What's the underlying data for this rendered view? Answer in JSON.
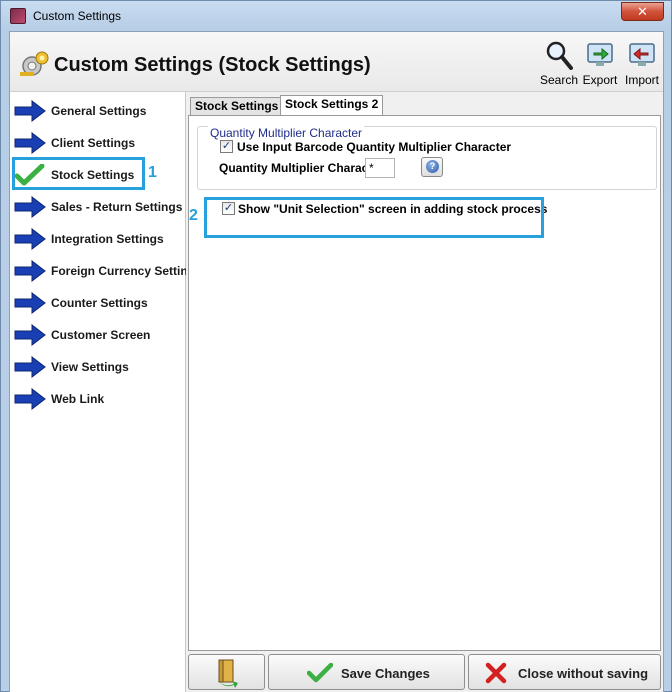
{
  "window": {
    "title": "Custom Settings",
    "close_glyph": "✕"
  },
  "header": {
    "title": "Custom Settings (Stock Settings)",
    "buttons": [
      {
        "label": "Search",
        "icon": "magnifier-icon"
      },
      {
        "label": "Export",
        "icon": "monitor-export-icon"
      },
      {
        "label": "Import",
        "icon": "monitor-import-icon"
      }
    ]
  },
  "sidebar": {
    "items": [
      {
        "label": "General Settings",
        "icon": "arrow-icon"
      },
      {
        "label": "Client Settings",
        "icon": "arrow-icon"
      },
      {
        "label": "Stock Settings",
        "icon": "checkmark-icon",
        "selected": true
      },
      {
        "label": "Sales - Return Settings",
        "icon": "arrow-icon"
      },
      {
        "label": "Integration Settings",
        "icon": "arrow-icon"
      },
      {
        "label": "Foreign Currency Settings",
        "icon": "arrow-icon"
      },
      {
        "label": "Counter Settings",
        "icon": "arrow-icon"
      },
      {
        "label": "Customer Screen",
        "icon": "arrow-icon"
      },
      {
        "label": "View Settings",
        "icon": "arrow-icon"
      },
      {
        "label": "Web Link",
        "icon": "arrow-icon"
      }
    ]
  },
  "annotations": {
    "one": "1",
    "two": "2",
    "color": "#27a1db"
  },
  "tabs": [
    {
      "label": "Stock Settings",
      "active": false
    },
    {
      "label": "Stock Settings 2",
      "active": true
    }
  ],
  "panel": {
    "group_title": "Quantity Multiplier Character",
    "use_barcode_label": "Use Input Barcode Quantity Multiplier Character",
    "use_barcode_checked": true,
    "qm_char_label": "Quantity Multiplier Charac",
    "qm_char_value": "*",
    "unit_selection_label": "Show \"Unit Selection\" screen in adding stock process",
    "unit_selection_checked": true
  },
  "footer": {
    "save_label": "Save Changes",
    "close_label": "Close without saving"
  }
}
